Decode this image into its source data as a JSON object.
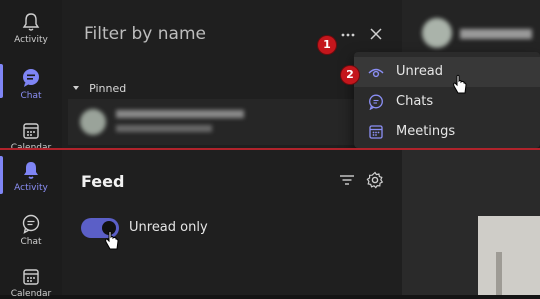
{
  "top": {
    "rail": {
      "items": [
        {
          "label": "Activity",
          "icon": "bell-icon"
        },
        {
          "label": "Chat",
          "icon": "chat-icon"
        },
        {
          "label": "Calendar",
          "icon": "calendar-icon"
        }
      ]
    },
    "filter": {
      "title": "Filter by name"
    },
    "pinned": {
      "label": "Pinned"
    },
    "menu": {
      "items": [
        {
          "label": "Unread",
          "icon": "eye-icon"
        },
        {
          "label": "Chats",
          "icon": "chat-bubble-icon"
        },
        {
          "label": "Meetings",
          "icon": "calendar-grid-icon"
        }
      ]
    },
    "badges": {
      "one": "1",
      "two": "2"
    }
  },
  "bottom": {
    "rail": {
      "items": [
        {
          "label": "Activity",
          "icon": "bell-icon"
        },
        {
          "label": "Chat",
          "icon": "chat-icon"
        },
        {
          "label": "Calendar",
          "icon": "calendar-icon"
        }
      ]
    },
    "feed": {
      "title": "Feed",
      "toggle_label": "Unread only",
      "toggle_on": true
    }
  },
  "colors": {
    "accent": "#7f85f5",
    "badge": "#c4161c",
    "toggle": "#5b5fc7"
  }
}
